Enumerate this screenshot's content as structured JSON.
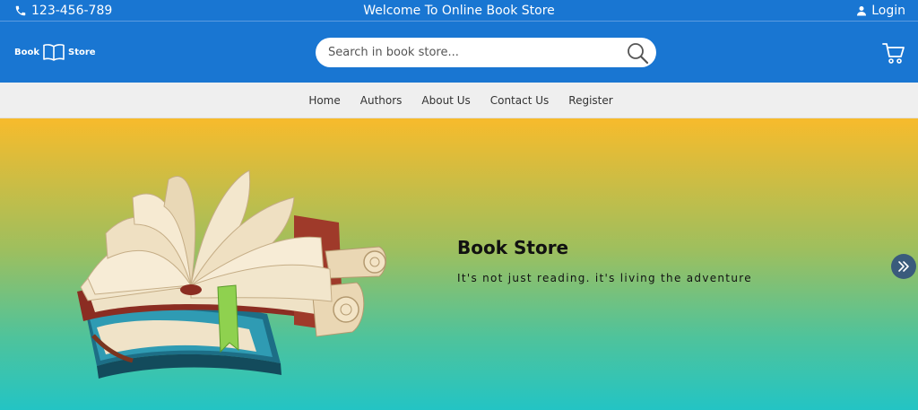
{
  "topbar": {
    "phone": "123-456-789",
    "welcome": "Welcome To Online Book Store",
    "login_label": "Login"
  },
  "header": {
    "logo_left": "Book",
    "logo_right": "Store",
    "search_placeholder": "Search in book store...",
    "icons": {
      "search": "search-icon",
      "cart": "cart-icon",
      "logo": "open-book-icon",
      "phone": "phone-icon",
      "user": "user-icon"
    }
  },
  "nav": {
    "items": [
      {
        "label": "Home"
      },
      {
        "label": "Authors"
      },
      {
        "label": "About Us"
      },
      {
        "label": "Contact Us"
      },
      {
        "label": "Register"
      }
    ]
  },
  "hero": {
    "title": "Book Store",
    "subtitle": "It's not just reading. it's living the adventure",
    "next_icon": "double-chevron-right-icon"
  },
  "colors": {
    "primary": "#1976d2",
    "nav_bg": "#efefef",
    "hero_top": "#f7bb2c",
    "hero_bottom": "#23c4c4",
    "slider_button": "#3a5b7c"
  }
}
